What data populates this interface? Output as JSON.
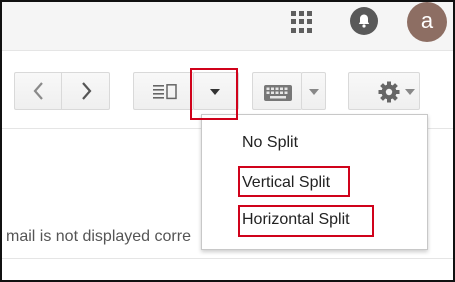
{
  "header": {
    "apps_icon": "apps-grid-icon",
    "notifications_icon": "bell-icon",
    "avatar_letter": "a",
    "avatar_color": "#8d6e63"
  },
  "toolbar": {
    "prev_icon": "chevron-left-icon",
    "next_icon": "chevron-right-icon",
    "split_icon": "split-pane-icon",
    "split_dropdown_icon": "caret-down-icon",
    "keyboard_icon": "keyboard-icon",
    "keyboard_dropdown_icon": "caret-down-icon",
    "settings_icon": "gear-icon"
  },
  "split_menu": {
    "items": [
      {
        "label": "No Split"
      },
      {
        "label": "Vertical Split"
      },
      {
        "label": "Horizontal Split"
      }
    ]
  },
  "message": {
    "notice": "mail is not displayed corre"
  },
  "colors": {
    "highlight": "#d0021b"
  }
}
